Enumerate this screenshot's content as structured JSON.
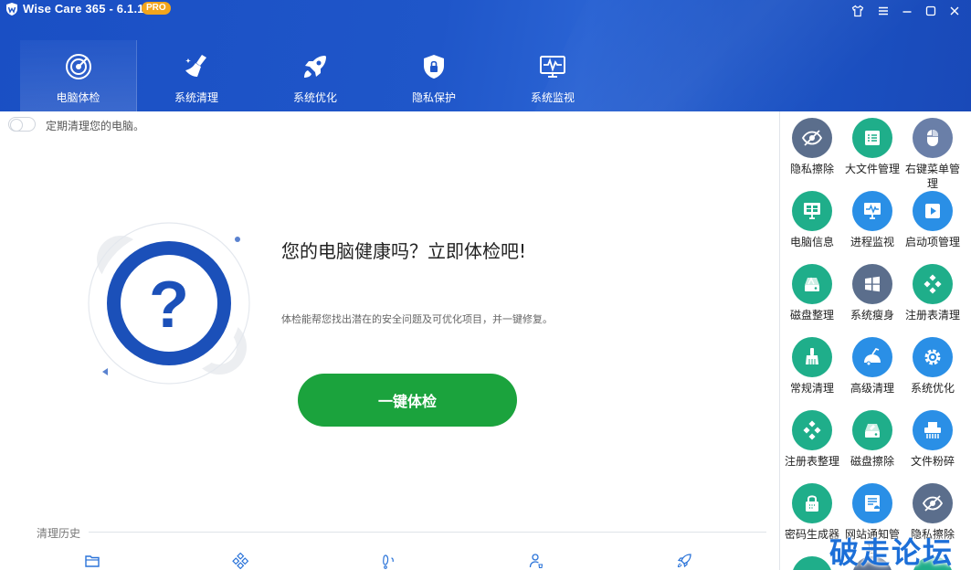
{
  "app": {
    "title": "Wise Care 365 - 6.1.1",
    "badge": "PRO"
  },
  "nav": {
    "tabs": [
      {
        "label": "电脑体检",
        "icon": "radar-icon"
      },
      {
        "label": "系统清理",
        "icon": "broom-icon"
      },
      {
        "label": "系统优化",
        "icon": "rocket-icon"
      },
      {
        "label": "隐私保护",
        "icon": "shield-lock-icon"
      },
      {
        "label": "系统监视",
        "icon": "monitor-pulse-icon"
      }
    ]
  },
  "schedule": {
    "label": "定期清理您的电脑。"
  },
  "hero": {
    "title": "您的电脑健康吗？立即体检吧!",
    "description": "体检能帮您找出潜在的安全问题及可优化项目，并一键修复。",
    "button": "一键体检"
  },
  "history": {
    "label": "清理历史"
  },
  "tools": [
    {
      "label": "隐私擦除",
      "icon": "eye-slash-icon",
      "color": "#5b6e8c"
    },
    {
      "label": "大文件管理",
      "icon": "files-icon",
      "color": "#1fae8a"
    },
    {
      "label": "右键菜单管理",
      "icon": "mouse-icon",
      "color": "#6a7fa8"
    },
    {
      "label": "电脑信息",
      "icon": "computer-icon",
      "color": "#1fae8a"
    },
    {
      "label": "进程监视",
      "icon": "process-monitor-icon",
      "color": "#2a8fe6"
    },
    {
      "label": "启动项管理",
      "icon": "play-icon",
      "color": "#2a8fe6"
    },
    {
      "label": "磁盘整理",
      "icon": "disk-icon",
      "color": "#1fae8a"
    },
    {
      "label": "系统瘦身",
      "icon": "windows-icon",
      "color": "#5b6e8c"
    },
    {
      "label": "注册表清理",
      "icon": "registry-icon",
      "color": "#1fae8a"
    },
    {
      "label": "常规清理",
      "icon": "brush-icon",
      "color": "#1fae8a"
    },
    {
      "label": "高级清理",
      "icon": "vacuum-icon",
      "color": "#2a8fe6"
    },
    {
      "label": "系统优化",
      "icon": "gear-icon",
      "color": "#2a8fe6"
    },
    {
      "label": "注册表整理",
      "icon": "registry-defrag-icon",
      "color": "#1fae8a"
    },
    {
      "label": "磁盘擦除",
      "icon": "disk-erase-icon",
      "color": "#1fae8a"
    },
    {
      "label": "文件粉碎",
      "icon": "shredder-icon",
      "color": "#2a8fe6"
    },
    {
      "label": "密码生成器",
      "icon": "lock-icon",
      "color": "#1fae8a"
    },
    {
      "label": "网站通知管理",
      "icon": "web-notify-icon",
      "color": "#2a8fe6"
    },
    {
      "label": "隐私擦除",
      "icon": "eye-slash-icon",
      "color": "#5b6e8c"
    }
  ],
  "watermark": "破走论坛"
}
